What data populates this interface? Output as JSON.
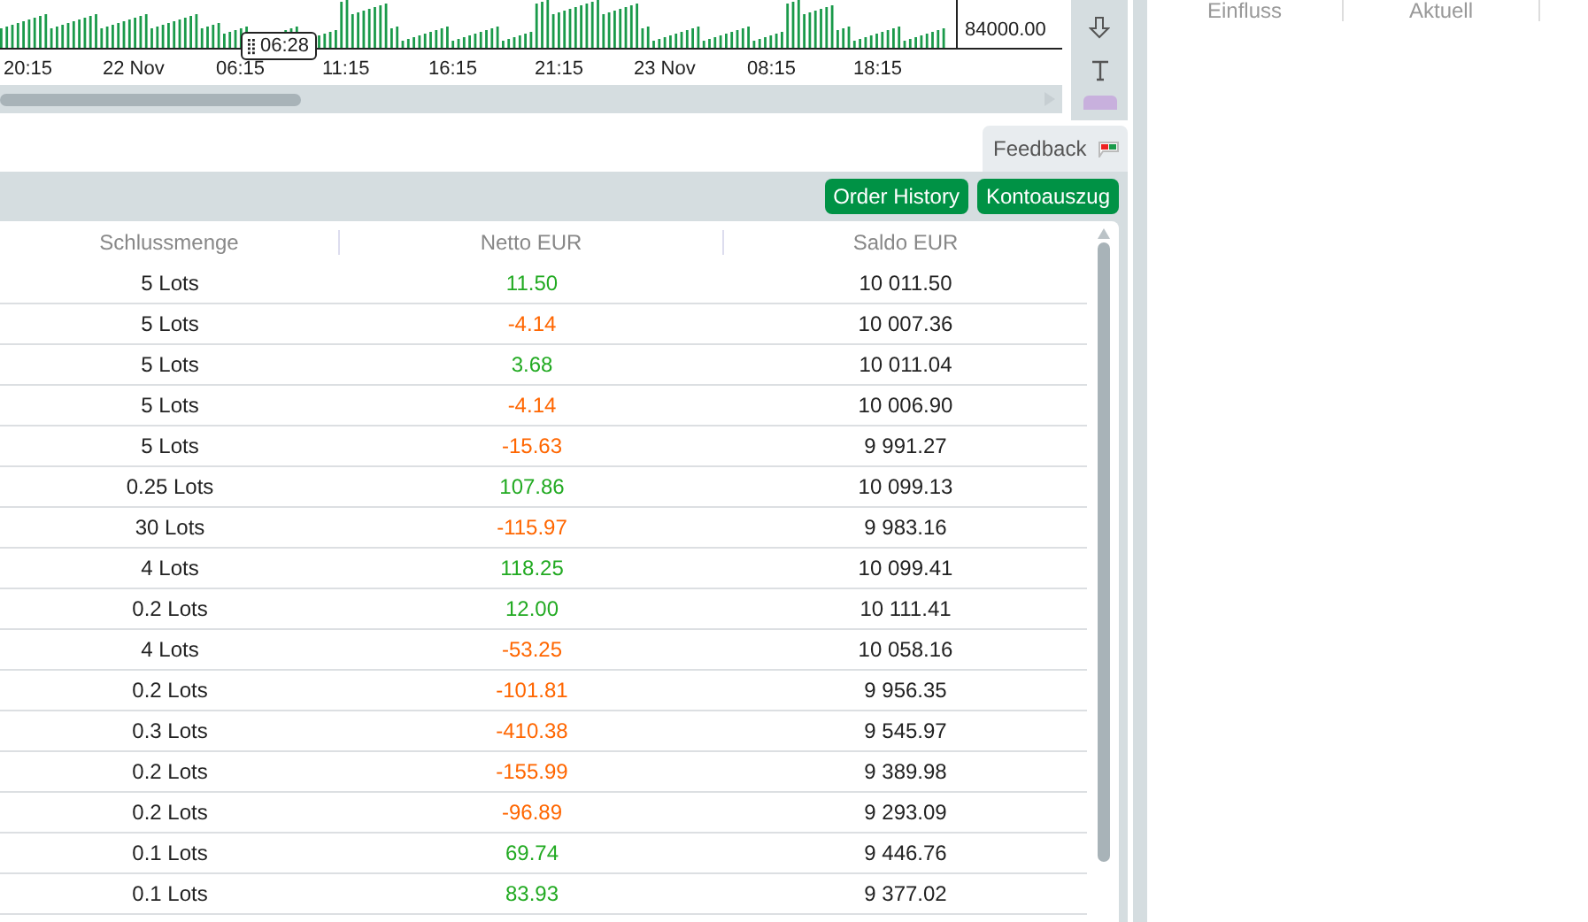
{
  "chart": {
    "price_label": "84000.00",
    "crosshair_time": "06:28",
    "time_labels": [
      "20:15",
      "22 Nov",
      "06:15",
      "11:15",
      "16:15",
      "21:15",
      "23 Nov",
      "08:15",
      "18:15"
    ]
  },
  "right_panel": {
    "columns": [
      "Einfluss",
      "Aktuell"
    ]
  },
  "feedback_tab": "Feedback",
  "buttons": [
    "Order History",
    "Kontoauszug"
  ],
  "table": {
    "columns": [
      "Schlussmenge",
      "Netto EUR",
      "Saldo EUR"
    ],
    "rows": [
      {
        "qty": "5 Lots",
        "net": "11.50",
        "color": "#22aa22",
        "balance": "10 011.50"
      },
      {
        "qty": "5 Lots",
        "net": "-4.14",
        "color": "#ff6600",
        "balance": "10 007.36"
      },
      {
        "qty": "5 Lots",
        "net": "3.68",
        "color": "#22aa22",
        "balance": "10 011.04"
      },
      {
        "qty": "5 Lots",
        "net": "-4.14",
        "color": "#ff6600",
        "balance": "10 006.90"
      },
      {
        "qty": "5 Lots",
        "net": "-15.63",
        "color": "#ff6600",
        "balance": "9 991.27"
      },
      {
        "qty": "0.25 Lots",
        "net": "107.86",
        "color": "#22aa22",
        "balance": "10 099.13"
      },
      {
        "qty": "30 Lots",
        "net": "-115.97",
        "color": "#ff6600",
        "balance": "9 983.16"
      },
      {
        "qty": "4 Lots",
        "net": "118.25",
        "color": "#22aa22",
        "balance": "10 099.41"
      },
      {
        "qty": "0.2 Lots",
        "net": "12.00",
        "color": "#22aa22",
        "balance": "10 111.41"
      },
      {
        "qty": "4 Lots",
        "net": "-53.25",
        "color": "#ff6600",
        "balance": "10 058.16"
      },
      {
        "qty": "0.2 Lots",
        "net": "-101.81",
        "color": "#ff6600",
        "balance": "9 956.35"
      },
      {
        "qty": "0.3 Lots",
        "net": "-410.38",
        "color": "#ff6600",
        "balance": "9 545.97"
      },
      {
        "qty": "0.2 Lots",
        "net": "-155.99",
        "color": "#ff6600",
        "balance": "9 389.98"
      },
      {
        "qty": "0.2 Lots",
        "net": "-96.89",
        "color": "#ff6600",
        "balance": "9 293.09"
      },
      {
        "qty": "0.1 Lots",
        "net": "69.74",
        "color": "#22aa22",
        "balance": "9 446.76"
      },
      {
        "qty": "0.1 Lots",
        "net": "83.93",
        "color": "#22aa22",
        "balance": "9 377.02"
      }
    ]
  }
}
